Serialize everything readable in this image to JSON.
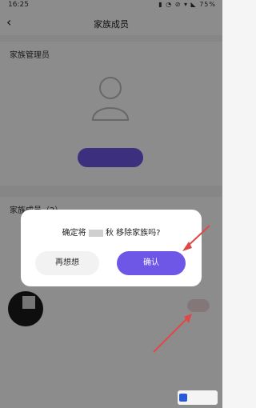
{
  "status_bar": {
    "time": "16:25",
    "right_text": "▮ ◔ ⊘ ▾ ◣ 75%"
  },
  "nav": {
    "title": "家族成员"
  },
  "admin_section": {
    "title": "家族管理员",
    "more": "",
    "caption": "",
    "set_admin_label": ""
  },
  "members_section": {
    "title": "家族成员（2）",
    "member": {
      "name": "",
      "meta": "",
      "remove_label": ""
    }
  },
  "dialog": {
    "message_before": "确定将",
    "message_after": "秋 移除家族吗?",
    "cancel_label": "再想想",
    "confirm_label": "确认"
  },
  "watermark": {
    "text": ""
  },
  "colors": {
    "accent": "#6e56e6",
    "arrow": "#e04848"
  }
}
